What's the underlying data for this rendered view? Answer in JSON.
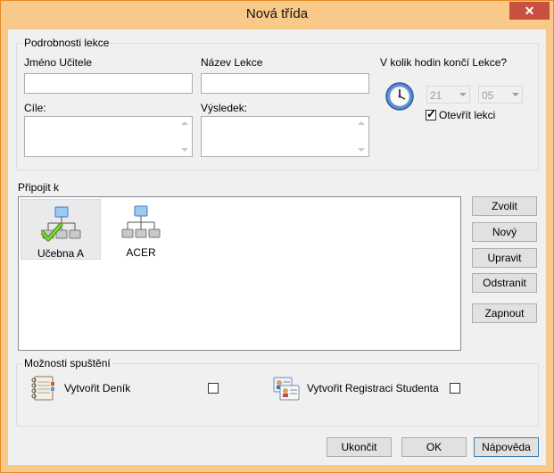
{
  "window": {
    "title": "Nová třída",
    "close_symbol": "✕"
  },
  "details": {
    "group_label": "Podrobnosti lekce",
    "teacher_name_label": "Jméno Učitele",
    "teacher_name_value": "",
    "lesson_name_label": "Název Lekce",
    "lesson_name_value": "",
    "end_time_label": "V kolik hodin končí Lekce?",
    "hour_value": "21",
    "minute_value": "05",
    "open_lesson_label": "Otevřít lekci",
    "open_lesson_checked": true,
    "goals_label": "Cíle:",
    "goals_value": "",
    "result_label": "Výsledek:",
    "result_value": ""
  },
  "connect": {
    "label": "Připojit k",
    "items": [
      {
        "label": "Učebna A",
        "icon": "network-connected-icon",
        "selected": true
      },
      {
        "label": "ACER",
        "icon": "network-icon",
        "selected": false
      }
    ],
    "buttons": {
      "choose": "Zvolit",
      "new": "Nový",
      "edit": "Upravit",
      "remove": "Odstranit",
      "turn_on": "Zapnout"
    }
  },
  "startup": {
    "group_label": "Možnosti spuštění",
    "create_journal_label": "Vytvořit Deník",
    "create_journal_checked": false,
    "create_registration_label": "Vytvořit Registraci Studenta",
    "create_registration_checked": false
  },
  "footer": {
    "quit": "Ukončit",
    "ok": "OK",
    "help": "Nápověda"
  },
  "colors": {
    "frame": "#f9c98a",
    "close": "#c7503f",
    "client": "#f0f0f0"
  }
}
